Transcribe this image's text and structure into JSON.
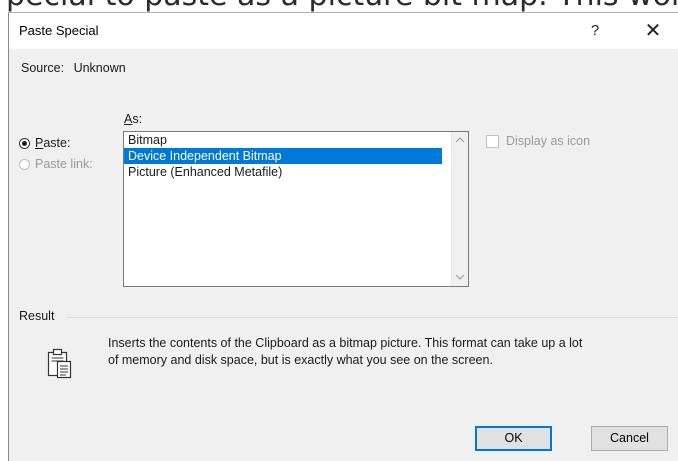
{
  "window": {
    "title": "Paste Special",
    "help_label": "?",
    "close_label": "✕"
  },
  "source": {
    "label": "Source:",
    "value": "Unknown"
  },
  "as_label": {
    "mnemonic": "A",
    "rest": "s:"
  },
  "paste_options": {
    "paste": {
      "mnemonic": "P",
      "rest": "aste:",
      "checked": true
    },
    "paste_link": {
      "label": "Paste link:",
      "enabled": false
    }
  },
  "formats": {
    "items": [
      "Bitmap",
      "Device Independent Bitmap",
      "Picture (Enhanced Metafile)"
    ],
    "selected_index": 1
  },
  "display_as_icon": {
    "label": "Display as icon",
    "checked": false,
    "enabled": false
  },
  "result": {
    "label": "Result",
    "line1": "Inserts the contents of the Clipboard as a bitmap picture. This format can take up a lot",
    "line2": "of memory and disk space, but is exactly what you see on the screen."
  },
  "buttons": {
    "ok": "OK",
    "cancel": "Cancel"
  },
  "icons": {
    "clipboard": "clipboard-icon",
    "scroll_up": "chevron-up-icon",
    "scroll_down": "chevron-down-icon"
  },
  "colors": {
    "selection": "#0078d7",
    "dialog_bg": "#f0f0f0"
  }
}
